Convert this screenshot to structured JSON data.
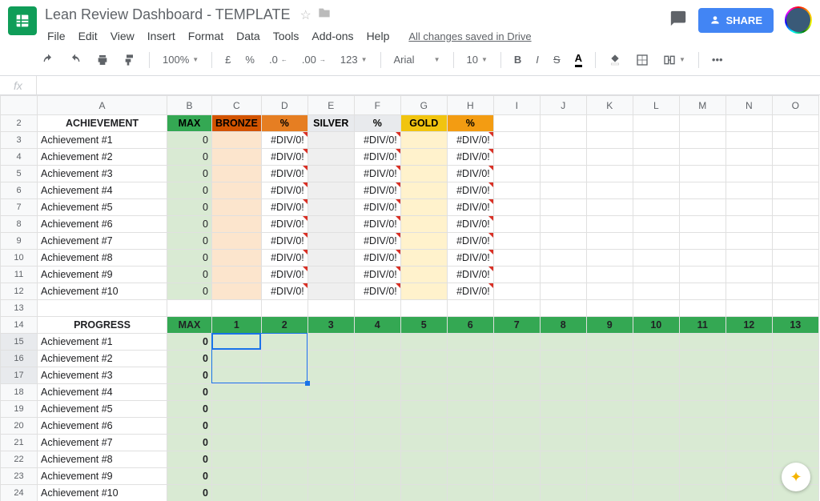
{
  "doc": {
    "title": "Lean Review Dashboard - TEMPLATE",
    "saved": "All changes saved in Drive"
  },
  "menus": [
    "File",
    "Edit",
    "View",
    "Insert",
    "Format",
    "Data",
    "Tools",
    "Add-ons",
    "Help"
  ],
  "share": "SHARE",
  "toolbar": {
    "zoom": "100%",
    "currency": "£",
    "percent": "%",
    "dec_dec": ".0",
    "dec_inc": ".00",
    "numfmt": "123",
    "font": "Arial",
    "size": "10"
  },
  "columns": [
    "A",
    "B",
    "C",
    "D",
    "E",
    "F",
    "G",
    "H",
    "I",
    "J",
    "K",
    "L",
    "M",
    "N",
    "O"
  ],
  "ach_header": {
    "title": "ACHIEVEMENT",
    "max": "MAX",
    "bronze": "BRONZE",
    "bronze_pct": "%",
    "silver": "SILVER",
    "silver_pct": "%",
    "gold": "GOLD",
    "gold_pct": "%"
  },
  "ach_rows": [
    {
      "n": "3",
      "label": "Achievement #1",
      "max": "0",
      "err": "#DIV/0!"
    },
    {
      "n": "4",
      "label": "Achievement #2",
      "max": "0",
      "err": "#DIV/0!"
    },
    {
      "n": "5",
      "label": "Achievement #3",
      "max": "0",
      "err": "#DIV/0!"
    },
    {
      "n": "6",
      "label": "Achievement #4",
      "max": "0",
      "err": "#DIV/0!"
    },
    {
      "n": "7",
      "label": "Achievement #5",
      "max": "0",
      "err": "#DIV/0!"
    },
    {
      "n": "8",
      "label": "Achievement #6",
      "max": "0",
      "err": "#DIV/0!"
    },
    {
      "n": "9",
      "label": "Achievement #7",
      "max": "0",
      "err": "#DIV/0!"
    },
    {
      "n": "10",
      "label": "Achievement #8",
      "max": "0",
      "err": "#DIV/0!"
    },
    {
      "n": "11",
      "label": "Achievement #9",
      "max": "0",
      "err": "#DIV/0!"
    },
    {
      "n": "12",
      "label": "Achievement #10",
      "max": "0",
      "err": "#DIV/0!"
    }
  ],
  "prog_header": {
    "title": "PROGRESS",
    "max": "MAX",
    "nums": [
      "1",
      "2",
      "3",
      "4",
      "5",
      "6",
      "7",
      "8",
      "9",
      "10",
      "11",
      "12",
      "13"
    ]
  },
  "prog_rows": [
    {
      "n": "15",
      "label": "Achievement #1",
      "max": "0"
    },
    {
      "n": "16",
      "label": "Achievement #2",
      "max": "0"
    },
    {
      "n": "17",
      "label": "Achievement #3",
      "max": "0"
    },
    {
      "n": "18",
      "label": "Achievement #4",
      "max": "0"
    },
    {
      "n": "19",
      "label": "Achievement #5",
      "max": "0"
    },
    {
      "n": "20",
      "label": "Achievement #6",
      "max": "0"
    },
    {
      "n": "21",
      "label": "Achievement #7",
      "max": "0"
    },
    {
      "n": "22",
      "label": "Achievement #8",
      "max": "0"
    },
    {
      "n": "23",
      "label": "Achievement #9",
      "max": "0"
    },
    {
      "n": "24",
      "label": "Achievement #10",
      "max": "0"
    }
  ],
  "row13": "13",
  "row14": "14",
  "row2": "2"
}
